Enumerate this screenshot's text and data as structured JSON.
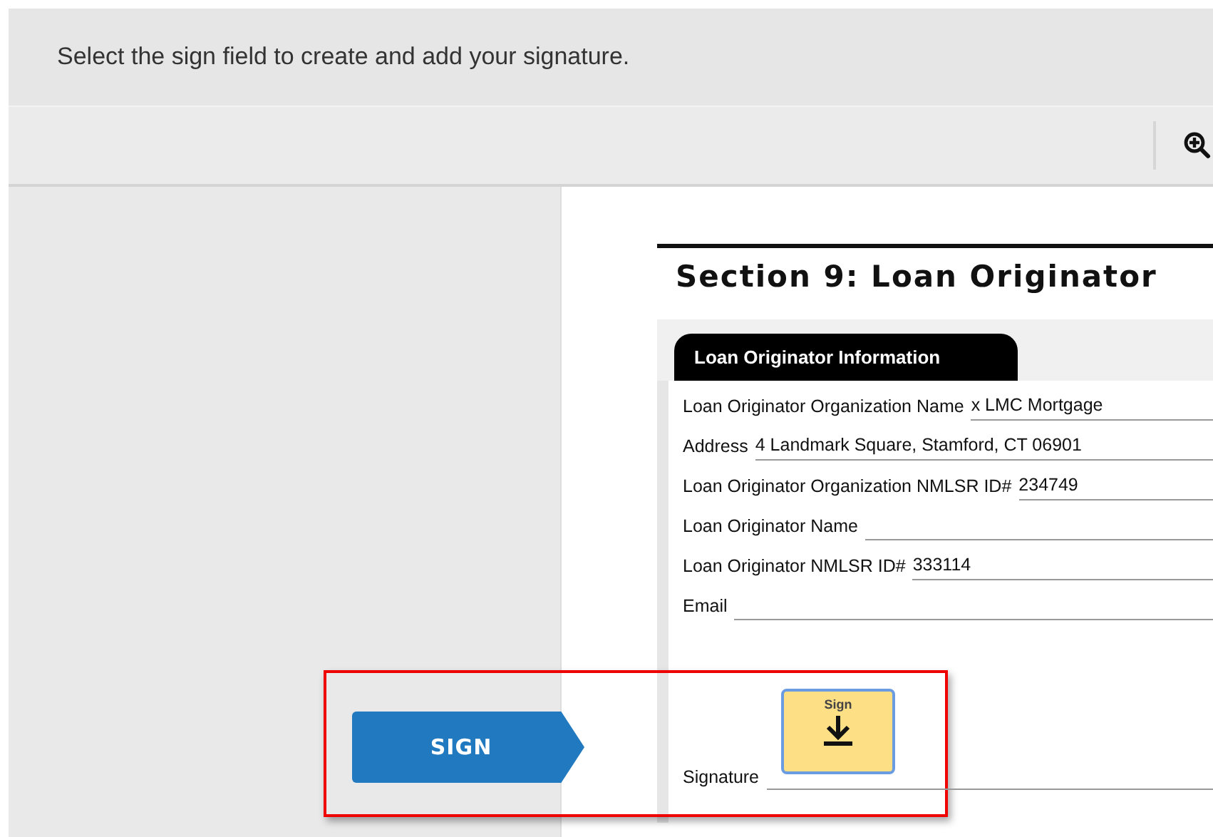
{
  "instruction": "Select the sign field to create and add your signature.",
  "section": {
    "title": "Section 9: Loan Originator",
    "tab": "Loan Originator Information",
    "fields": [
      {
        "label": "Loan Originator Organization Name",
        "value": "x LMC Mortgage"
      },
      {
        "label": "Address",
        "value": "4 Landmark Square, Stamford, CT 06901"
      },
      {
        "label": "Loan Originator Organization NMLSR ID#",
        "value": "234749"
      },
      {
        "label": "Loan Originator Name"
      },
      {
        "label": "Loan Originator NMLSR ID#",
        "value": "333114"
      },
      {
        "label": "Email"
      }
    ],
    "signature": {
      "label": "Signature",
      "sign_field": "Sign"
    }
  },
  "sign_button": "SIGN"
}
